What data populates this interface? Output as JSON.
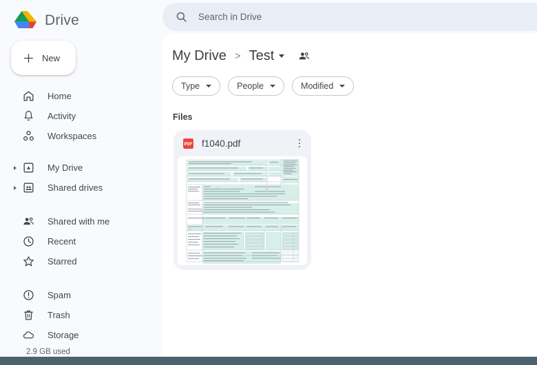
{
  "brand": {
    "name": "Drive",
    "logo_icon": "drive-logo"
  },
  "new_button": {
    "label": "New",
    "icon": "plus-icon"
  },
  "sidebar": {
    "groups": [
      {
        "items": [
          {
            "label": "Home",
            "icon": "home-icon",
            "expandable": false
          },
          {
            "label": "Activity",
            "icon": "bell-icon",
            "expandable": false
          },
          {
            "label": "Workspaces",
            "icon": "workspaces-icon",
            "expandable": false
          }
        ]
      },
      {
        "items": [
          {
            "label": "My Drive",
            "icon": "my-drive-icon",
            "expandable": true
          },
          {
            "label": "Shared drives",
            "icon": "shared-drives-icon",
            "expandable": true
          }
        ]
      },
      {
        "items": [
          {
            "label": "Shared with me",
            "icon": "people-icon",
            "expandable": false
          },
          {
            "label": "Recent",
            "icon": "clock-icon",
            "expandable": false
          },
          {
            "label": "Starred",
            "icon": "star-icon",
            "expandable": false
          }
        ]
      },
      {
        "items": [
          {
            "label": "Spam",
            "icon": "spam-icon",
            "expandable": false
          },
          {
            "label": "Trash",
            "icon": "trash-icon",
            "expandable": false
          },
          {
            "label": "Storage",
            "icon": "cloud-icon",
            "expandable": false
          }
        ]
      }
    ],
    "storage_used": "2.9 GB used"
  },
  "search": {
    "placeholder": "Search in Drive",
    "value": "",
    "icon": "search-icon"
  },
  "breadcrumb": {
    "root": "My Drive",
    "separator": ">",
    "current": "Test",
    "share_icon": "share-people-icon"
  },
  "filters": [
    {
      "label": "Type"
    },
    {
      "label": "People"
    },
    {
      "label": "Modified"
    }
  ],
  "files_section": {
    "title": "Files",
    "items": [
      {
        "name": "f1040.pdf",
        "type_icon": "pdf-icon",
        "type_label": "PDF",
        "menu_icon": "more-vert-icon",
        "thumbnail": "irs-form-1040-preview"
      }
    ]
  },
  "colors": {
    "sidebar_bg": "#f8fafd",
    "panel_bg": "#ffffff",
    "search_bg": "#e9eef6",
    "card_bg": "#f0f2f7",
    "pdf_red": "#e8453c",
    "form_teal": "#d6efe9",
    "bottom_bar": "#4c626c",
    "text_primary": "#3c4043",
    "text_secondary": "#5f6368"
  }
}
